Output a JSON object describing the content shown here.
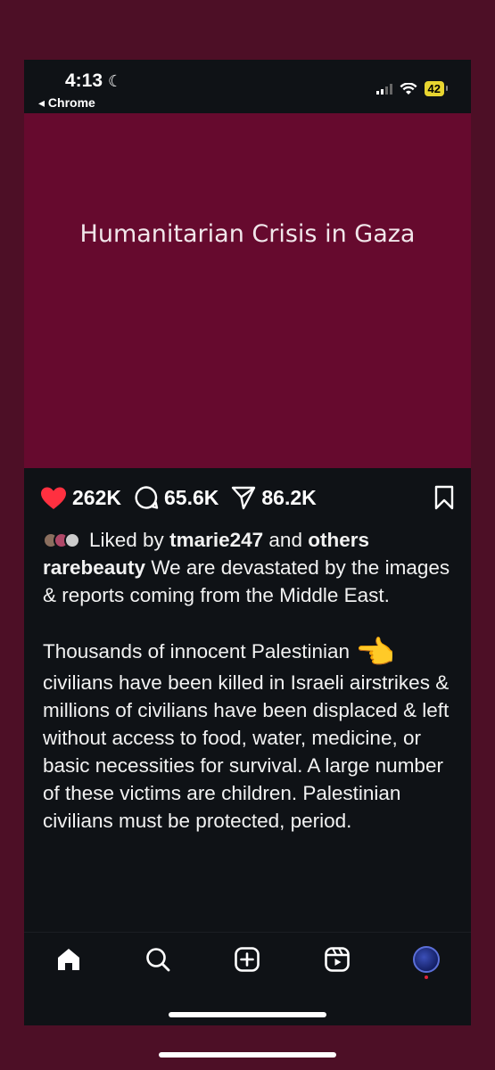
{
  "status_bar": {
    "time": "4:13",
    "back_app": "◂ Chrome",
    "battery": "42"
  },
  "post": {
    "image_title": "Humanitarian Crisis in Gaza",
    "likes": "262K",
    "comments": "65.6K",
    "shares": "86.2K",
    "liked_by_prefix": "Liked by",
    "liked_by_user": "tmarie247",
    "liked_by_and": "and",
    "liked_by_others": "others",
    "author": "rarebeauty",
    "caption_p1": "We are devastated by the images & reports coming from the Middle East.",
    "caption_p2": "Thousands of innocent Palestinian",
    "caption_p2_rest": "civilians have been killed in Israeli airstrikes & millions of civilians have been displaced & left without access to food, water, medicine, or basic necessities for survival. A large number of these victims are children. Palestinian civilians must be protected, period.",
    "emoji": "👈"
  },
  "colors": {
    "background": "#4d0f26",
    "post_image": "#660a2e",
    "feed_background": "#0f1216",
    "heart": "#ff3040"
  },
  "nav": {
    "items": [
      "home-icon",
      "search-icon",
      "create-icon",
      "reels-icon",
      "profile-avatar"
    ]
  }
}
